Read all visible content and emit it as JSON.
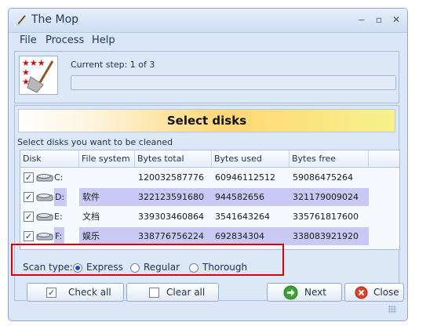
{
  "window": {
    "title": "The Mop"
  },
  "menu": [
    "File",
    "Process",
    "Help"
  ],
  "header": {
    "step": "Current step: 1 of 3",
    "progress": 0
  },
  "banner": "Select disks",
  "instruction": "Select disks you want to be cleaned",
  "table": {
    "columns": [
      "Disk",
      "File system",
      "Bytes total",
      "Bytes used",
      "Bytes free"
    ],
    "rows": [
      {
        "checked": true,
        "disk": "C:",
        "fs": "",
        "total": "120032587776",
        "used": "60946112512",
        "free": "59086475264"
      },
      {
        "checked": true,
        "disk": "D:",
        "fs": "软件",
        "total": "322123591680",
        "used": "944582656",
        "free": "321179009024"
      },
      {
        "checked": true,
        "disk": "E:",
        "fs": "文档",
        "total": "339303460864",
        "used": "3541643264",
        "free": "335761817600"
      },
      {
        "checked": true,
        "disk": "F:",
        "fs": "娱乐",
        "total": "338776756224",
        "used": "692834304",
        "free": "338083921920"
      }
    ]
  },
  "scan": {
    "label": "Scan type:",
    "options": [
      {
        "label": "Express",
        "selected": true
      },
      {
        "label": "Regular",
        "selected": false
      },
      {
        "label": "Thorough",
        "selected": false
      }
    ]
  },
  "buttons": {
    "check_all": "Check all",
    "clear_all": "Clear all",
    "next": "Next",
    "close": "Close"
  },
  "colors": {
    "highlight": "#e00000",
    "row_shade": "#c8c9f4",
    "banner_accent": "#ffd774"
  },
  "icons": {
    "title": "mop-icon",
    "app": "mop-broom-icon",
    "drive": "hard-drive-icon",
    "next": "green-arrow-icon",
    "close": "red-x-icon"
  }
}
